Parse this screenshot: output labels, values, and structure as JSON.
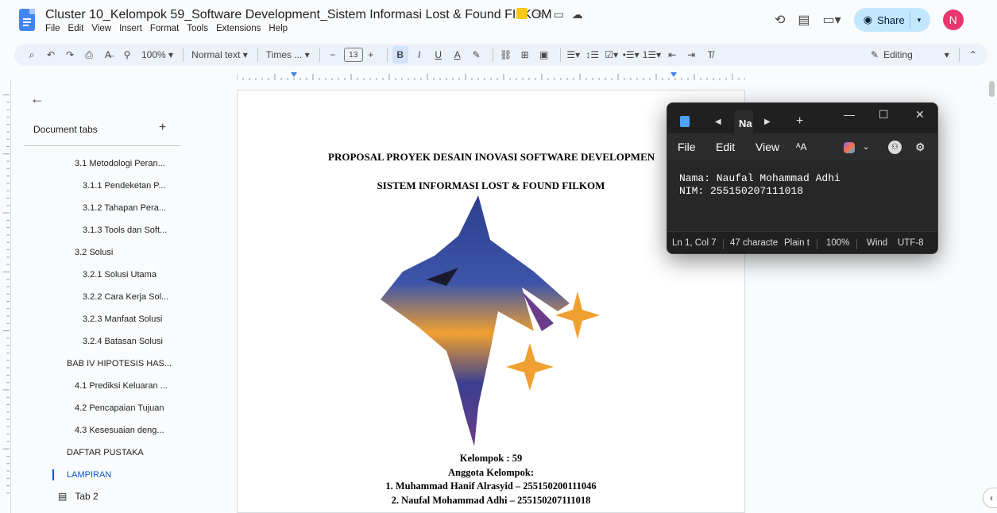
{
  "doc": {
    "title": "Cluster 10_Kelompok 59_Software Development_Sistem Informasi Lost & Found FILKOM",
    "menu": [
      "File",
      "Edit",
      "View",
      "Insert",
      "Format",
      "Tools",
      "Extensions",
      "Help"
    ]
  },
  "header": {
    "share_label": "Share",
    "avatar_letter": "N"
  },
  "toolbar": {
    "zoom": "100%",
    "style": "Normal text",
    "font": "Times ...",
    "font_size": "13",
    "editing_label": "Editing"
  },
  "sidebar": {
    "doc_tabs_label": "Document tabs",
    "items": [
      {
        "label": "3.1 Metodologi Peran...",
        "level": 1
      },
      {
        "label": "3.1.1 Pendeketan P...",
        "level": 2
      },
      {
        "label": "3.1.2 Tahapan Pera...",
        "level": 2
      },
      {
        "label": "3.1.3 Tools dan Soft...",
        "level": 2
      },
      {
        "label": "3.2 Solusi",
        "level": 1
      },
      {
        "label": "3.2.1 Solusi Utama",
        "level": 2
      },
      {
        "label": "3.2.2 Cara Kerja Sol...",
        "level": 2
      },
      {
        "label": "3.2.3 Manfaat Solusi",
        "level": 2
      },
      {
        "label": "3.2.4 Batasan Solusi",
        "level": 2
      },
      {
        "label": "BAB IV HIPOTESIS HAS...",
        "level": 0
      },
      {
        "label": "4.1 Prediksi Keluaran ...",
        "level": 1
      },
      {
        "label": "4.2 Pencapaian Tujuan",
        "level": 1
      },
      {
        "label": "4.3 Kesesuaian deng...",
        "level": 1
      },
      {
        "label": "DAFTAR PUSTAKA",
        "level": 0
      },
      {
        "label": "LAMPIRAN",
        "level": 0
      }
    ],
    "tab2_label": "Tab 2"
  },
  "page": {
    "title1": "PROPOSAL PROYEK DESAIN INOVASI SOFTWARE DEVELOPMEN",
    "title2": "SISTEM INFORMASI LOST & FOUND FILKOM",
    "group": "Kelompok : 59",
    "members_heading": "Anggota Kelompok:",
    "member1": "1. Muhammad Hanif Alrasyid – 255150200111046",
    "member2": "2. Naufal Mohammad Adhi – 255150207111018"
  },
  "notepad": {
    "tab_label": "Na",
    "menu": [
      "File",
      "Edit",
      "View"
    ],
    "line1": "Nama: Naufal Mohammad Adhi",
    "line2": "NIM: 255150207111018",
    "status": {
      "position": "Ln 1, Col 7",
      "chars": "47 characte",
      "format": "Plain t",
      "zoom": "100%",
      "eol": "Wind",
      "encoding": "UTF-8"
    }
  },
  "colors": {
    "accent": "#0b57d0",
    "share_bg": "#c2e7ff",
    "avatar_bg": "#e8366f"
  }
}
